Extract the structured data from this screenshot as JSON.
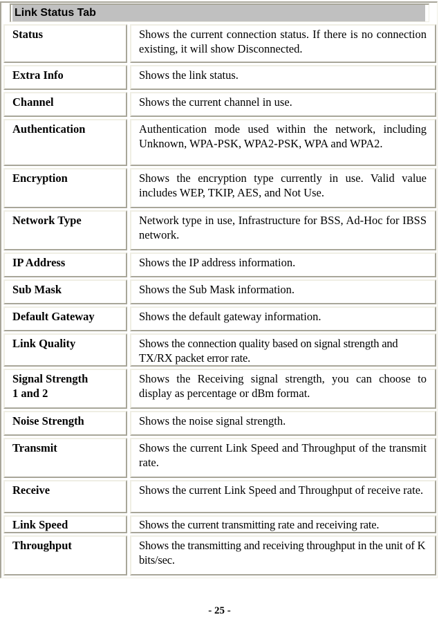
{
  "table": {
    "title": "Link Status Tab",
    "rows": [
      {
        "label": "Status",
        "description": "Shows the current connection status. If there is no connection existing, it will show Disconnected."
      },
      {
        "label": "Extra Info",
        "description": "Shows the link status."
      },
      {
        "label": "Channel",
        "description": "Shows the current channel in use."
      },
      {
        "label": "Authentication",
        "description": "Authentication mode used within the network, including Unknown, WPA-PSK, WPA2-PSK, WPA and WPA2."
      },
      {
        "label": "Encryption",
        "description": "Shows the encryption type currently in use. Valid value includes WEP, TKIP, AES, and Not Use."
      },
      {
        "label": "Network Type",
        "description": "Network type in use, Infrastructure for BSS, Ad-Hoc for IBSS network."
      },
      {
        "label": "IP Address",
        "description": "Shows the IP address information."
      },
      {
        "label": "Sub Mask",
        "description": "Shows the Sub Mask information."
      },
      {
        "label": "Default Gateway",
        "description": "Shows the default gateway information."
      },
      {
        "label": "Link Quality",
        "description": "Shows the connection quality based on signal strength and TX/RX packet error rate."
      },
      {
        "label": "Signal Strength\n1 and 2",
        "description": "Shows the Receiving signal strength, you can choose to display as percentage or dBm format."
      },
      {
        "label": "Noise Strength",
        "description": "Shows the noise signal strength."
      },
      {
        "label": "Transmit",
        "description": "Shows the current Link Speed and Throughput of the transmit rate."
      },
      {
        "label": "Receive",
        "description": "Shows the current Link Speed and Throughput of receive rate."
      },
      {
        "label": "Link Speed",
        "description": "Shows the current transmitting rate and receiving rate."
      },
      {
        "label": "Throughput",
        "description": "Shows the transmitting and receiving throughput in the unit of K bits/sec."
      }
    ]
  },
  "footer": {
    "page_number": "- 25 -"
  }
}
